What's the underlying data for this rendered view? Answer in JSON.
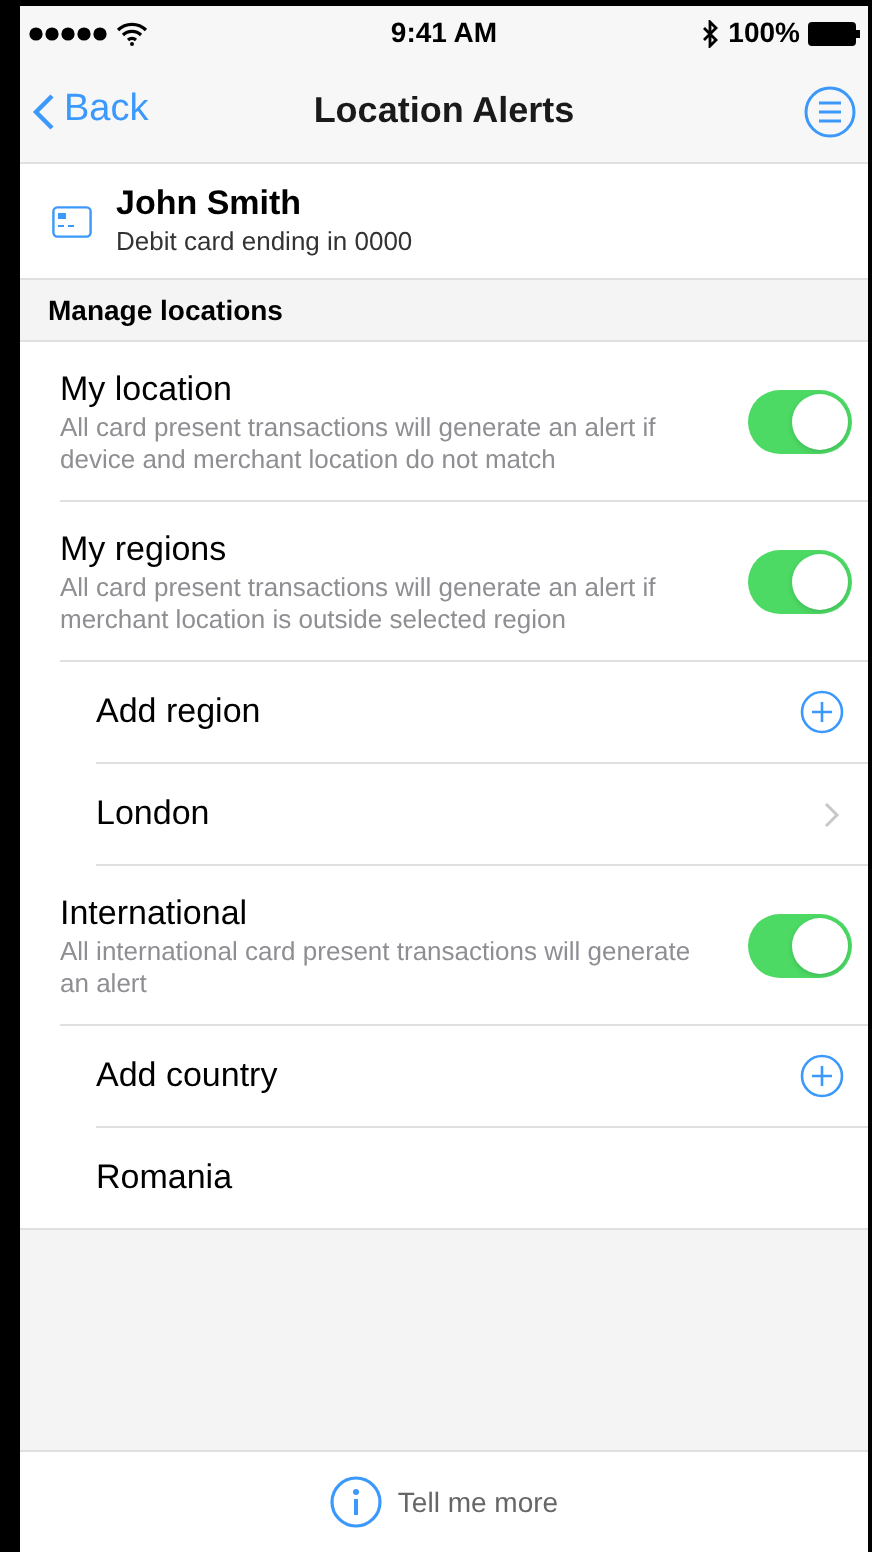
{
  "status_bar": {
    "time": "9:41 AM",
    "battery": "100%"
  },
  "nav": {
    "back": "Back",
    "title": "Location Alerts"
  },
  "card": {
    "name": "John Smith",
    "subtitle": "Debit card ending in 0000"
  },
  "section": {
    "title": "Manage locations"
  },
  "items": [
    {
      "kind": "toggle",
      "title": "My location",
      "description": "All card present transactions will generate an alert if device and merchant location do not match",
      "on": true
    },
    {
      "kind": "toggle",
      "title": "My regions",
      "description": "All card present transactions will generate an alert if merchant location is outside selected region",
      "on": true
    },
    {
      "kind": "add",
      "title": "Add region"
    },
    {
      "kind": "link",
      "title": "London"
    },
    {
      "kind": "toggle",
      "title": "International",
      "description": "All international card present transactions will generate an alert",
      "on": true
    },
    {
      "kind": "add",
      "title": "Add country"
    },
    {
      "kind": "plain",
      "title": "Romania"
    }
  ],
  "footer": {
    "link": "Tell me more"
  }
}
